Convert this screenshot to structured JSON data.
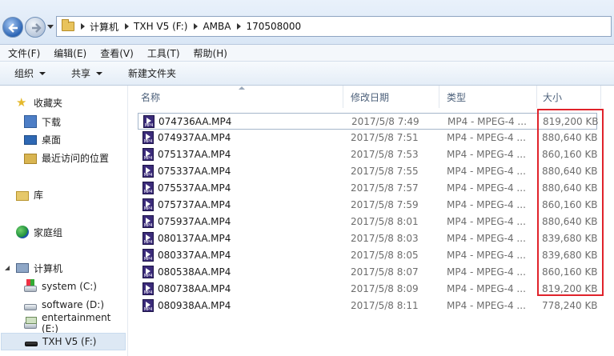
{
  "address": {
    "breadcrumbs": [
      "计算机",
      "TXH V5 (F:)",
      "AMBA",
      "170508000"
    ]
  },
  "menubar": {
    "items": [
      "文件(F)",
      "编辑(E)",
      "查看(V)",
      "工具(T)",
      "帮助(H)"
    ]
  },
  "toolbar": {
    "organize": "组织",
    "share": "共享",
    "new_folder": "新建文件夹"
  },
  "nav": {
    "favorites": "收藏夹",
    "downloads": "下载",
    "desktop": "桌面",
    "recent": "最近访问的位置",
    "libraries": "库",
    "homegroup": "家庭组",
    "computer": "计算机",
    "drive_c": "system (C:)",
    "drive_d": "software (D:)",
    "drive_e": "entertainment (E:)",
    "drive_f": "TXH V5 (F:)"
  },
  "columns": {
    "name": "名称",
    "date": "修改日期",
    "type": "类型",
    "size": "大小"
  },
  "files": [
    {
      "name": "074736AA.MP4",
      "date": "2017/5/8 7:49",
      "type": "MP4 - MPEG-4 ...",
      "size": "819,200 KB"
    },
    {
      "name": "074937AA.MP4",
      "date": "2017/5/8 7:51",
      "type": "MP4 - MPEG-4 ...",
      "size": "880,640 KB"
    },
    {
      "name": "075137AA.MP4",
      "date": "2017/5/8 7:53",
      "type": "MP4 - MPEG-4 ...",
      "size": "860,160 KB"
    },
    {
      "name": "075337AA.MP4",
      "date": "2017/5/8 7:55",
      "type": "MP4 - MPEG-4 ...",
      "size": "880,640 KB"
    },
    {
      "name": "075537AA.MP4",
      "date": "2017/5/8 7:57",
      "type": "MP4 - MPEG-4 ...",
      "size": "880,640 KB"
    },
    {
      "name": "075737AA.MP4",
      "date": "2017/5/8 7:59",
      "type": "MP4 - MPEG-4 ...",
      "size": "860,160 KB"
    },
    {
      "name": "075937AA.MP4",
      "date": "2017/5/8 8:01",
      "type": "MP4 - MPEG-4 ...",
      "size": "880,640 KB"
    },
    {
      "name": "080137AA.MP4",
      "date": "2017/5/8 8:03",
      "type": "MP4 - MPEG-4 ...",
      "size": "839,680 KB"
    },
    {
      "name": "080337AA.MP4",
      "date": "2017/5/8 8:05",
      "type": "MP4 - MPEG-4 ...",
      "size": "839,680 KB"
    },
    {
      "name": "080538AA.MP4",
      "date": "2017/5/8 8:07",
      "type": "MP4 - MPEG-4 ...",
      "size": "860,160 KB"
    },
    {
      "name": "080738AA.MP4",
      "date": "2017/5/8 8:09",
      "type": "MP4 - MPEG-4 ...",
      "size": "819,200 KB"
    },
    {
      "name": "080938AA.MP4",
      "date": "2017/5/8 8:11",
      "type": "MP4 - MPEG-4 ...",
      "size": "778,240 KB"
    }
  ],
  "colors": {
    "highlight": "#e0232b",
    "selection": "#dde8f4"
  }
}
